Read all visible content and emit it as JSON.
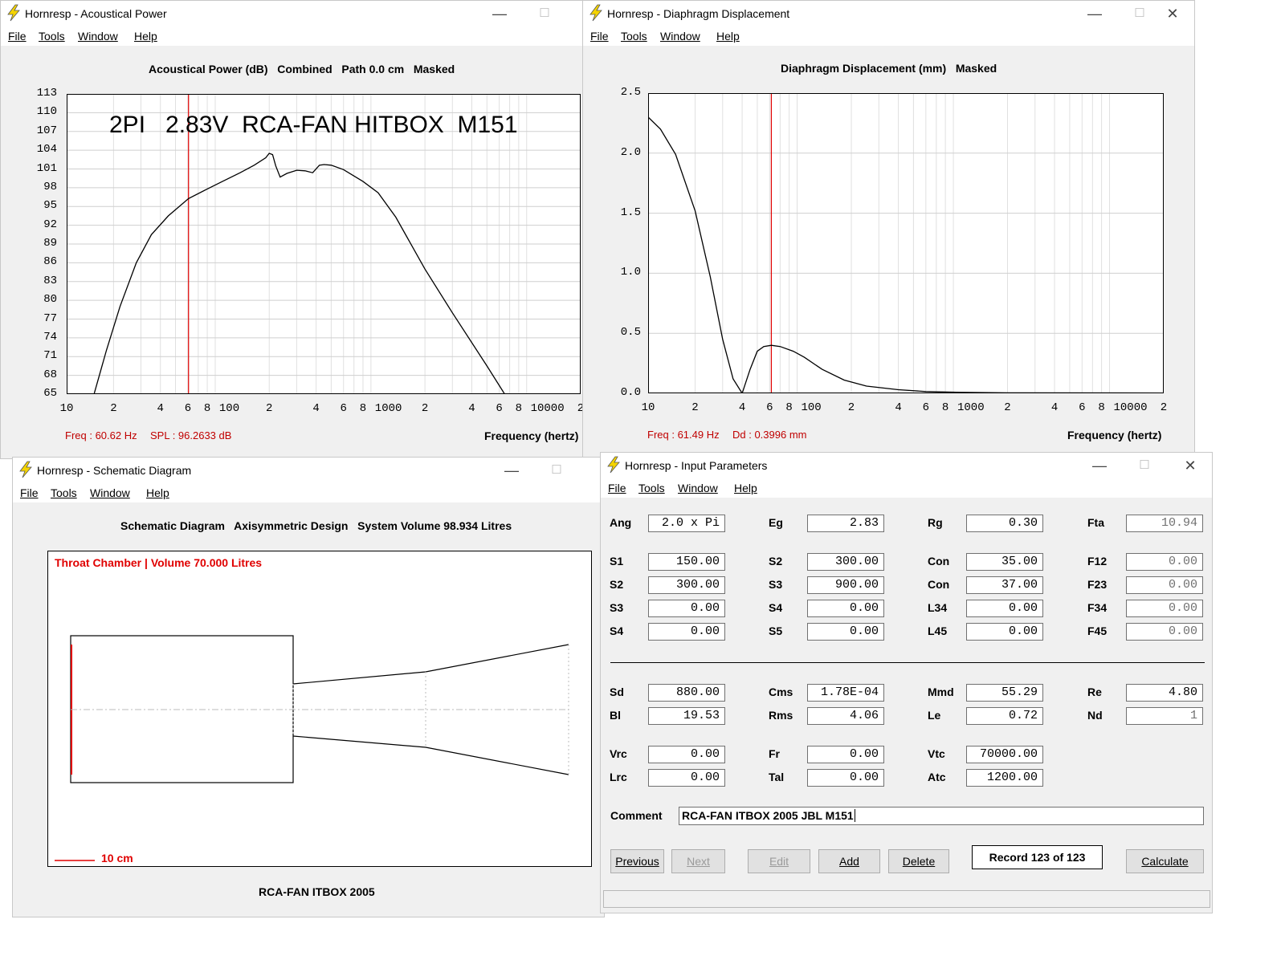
{
  "menus": [
    "File",
    "Tools",
    "Window",
    "Help"
  ],
  "window_controls": {
    "minimize": "—",
    "maximize": "☐",
    "close": "✕"
  },
  "acoustical_power": {
    "window_title": "Hornresp - Acoustical Power",
    "plot_title": "Acoustical Power (dB)   Combined   Path 0.0 cm   Masked",
    "annotation": "2PI   2.83V  RCA-FAN HITBOX  M151",
    "status_freq": "Freq : 60.62 Hz",
    "status_value": "SPL : 96.2633 dB",
    "xlabel": "Frequency (hertz)"
  },
  "diaphragm_displacement": {
    "window_title": "Hornresp - Diaphragm Displacement",
    "plot_title": "Diaphragm Displacement (mm)   Masked",
    "status_freq": "Freq : 61.49 Hz",
    "status_value": "Dd : 0.3996 mm",
    "xlabel": "Frequency (hertz)"
  },
  "chart_data": [
    {
      "type": "line",
      "x_scale": "log",
      "xlim": [
        10,
        20000
      ],
      "ylim": [
        65,
        113
      ],
      "yticks": [
        "113",
        "110",
        "107",
        "104",
        "101",
        "98",
        "95",
        "92",
        "89",
        "86",
        "83",
        "80",
        "77",
        "74",
        "71",
        "68",
        "65"
      ],
      "xticks": [
        "10",
        "2",
        "4",
        "6",
        "8",
        "100",
        "2",
        "4",
        "6",
        "8",
        "1000",
        "2",
        "4",
        "6",
        "8",
        "10000",
        "2"
      ],
      "cursor_x": 60.62,
      "x": [
        15,
        18,
        22,
        28,
        35,
        45,
        60.62,
        80,
        100,
        130,
        160,
        190,
        200,
        210,
        220,
        235,
        260,
        300,
        340,
        380,
        420,
        450,
        500,
        600,
        800,
        1000,
        1300,
        1600,
        2000,
        3000,
        5000,
        6500
      ],
      "y": [
        65,
        72,
        79,
        86,
        90.5,
        93.5,
        96.2633,
        97.8,
        99,
        100.4,
        101.6,
        102.8,
        103.5,
        103.3,
        101.5,
        99.7,
        100.3,
        100.8,
        100.7,
        100.4,
        101.6,
        101.7,
        101.6,
        100.9,
        99,
        97.2,
        93.3,
        89.3,
        85,
        78,
        69.5,
        65
      ]
    },
    {
      "type": "line",
      "x_scale": "log",
      "xlim": [
        10,
        20000
      ],
      "ylim": [
        0,
        2.5
      ],
      "yticks": [
        "2.5",
        "2.0",
        "1.5",
        "1.0",
        "0.5",
        "0.0"
      ],
      "xticks": [
        "10",
        "2",
        "4",
        "6",
        "8",
        "100",
        "2",
        "4",
        "6",
        "8",
        "1000",
        "2",
        "4",
        "6",
        "8",
        "10000",
        "2"
      ],
      "cursor_x": 61.49,
      "x": [
        10,
        12,
        15,
        20,
        25,
        30,
        35,
        40,
        45,
        50,
        55,
        61.49,
        70,
        85,
        100,
        130,
        180,
        250,
        400,
        600,
        1000,
        2000,
        20000
      ],
      "y": [
        2.3,
        2.2,
        1.99,
        1.52,
        0.97,
        0.45,
        0.12,
        0.0,
        0.2,
        0.35,
        0.39,
        0.3996,
        0.39,
        0.35,
        0.3,
        0.2,
        0.11,
        0.06,
        0.03,
        0.015,
        0.008,
        0.004,
        0.003
      ]
    }
  ],
  "schematic": {
    "window_title": "Hornresp - Schematic Diagram",
    "header": "Schematic Diagram   Axisymmetric Design   System Volume 98.934 Litres",
    "chamber_label": "Throat Chamber | Volume 70.000 Litres",
    "scale_label": "10 cm",
    "footer": "RCA-FAN ITBOX 2005"
  },
  "input_parameters": {
    "window_title": "Hornresp - Input Parameters",
    "rows": [
      [
        {
          "label": "Ang",
          "value": "2.0 x Pi",
          "ro": false
        },
        {
          "label": "Eg",
          "value": "2.83",
          "ro": false
        },
        {
          "label": "Rg",
          "value": "0.30",
          "ro": false
        },
        {
          "label": "Fta",
          "value": "10.94",
          "ro": true
        }
      ],
      [
        {
          "label": "S1",
          "value": "150.00",
          "ro": false
        },
        {
          "label": "S2",
          "value": "300.00",
          "ro": false
        },
        {
          "label": "Con",
          "value": "35.00",
          "ro": false
        },
        {
          "label": "F12",
          "value": "0.00",
          "ro": true
        }
      ],
      [
        {
          "label": "S2",
          "value": "300.00",
          "ro": false
        },
        {
          "label": "S3",
          "value": "900.00",
          "ro": false
        },
        {
          "label": "Con",
          "value": "37.00",
          "ro": false
        },
        {
          "label": "F23",
          "value": "0.00",
          "ro": true
        }
      ],
      [
        {
          "label": "S3",
          "value": "0.00",
          "ro": false
        },
        {
          "label": "S4",
          "value": "0.00",
          "ro": false
        },
        {
          "label": "L34",
          "value": "0.00",
          "ro": false
        },
        {
          "label": "F34",
          "value": "0.00",
          "ro": true
        }
      ],
      [
        {
          "label": "S4",
          "value": "0.00",
          "ro": false
        },
        {
          "label": "S5",
          "value": "0.00",
          "ro": false
        },
        {
          "label": "L45",
          "value": "0.00",
          "ro": false
        },
        {
          "label": "F45",
          "value": "0.00",
          "ro": true
        }
      ],
      [
        {
          "label": "Sd",
          "value": "880.00",
          "ro": false
        },
        {
          "label": "Cms",
          "value": "1.78E-04",
          "ro": false
        },
        {
          "label": "Mmd",
          "value": "55.29",
          "ro": false
        },
        {
          "label": "Re",
          "value": "4.80",
          "ro": false
        }
      ],
      [
        {
          "label": "Bl",
          "value": "19.53",
          "ro": false
        },
        {
          "label": "Rms",
          "value": "4.06",
          "ro": false
        },
        {
          "label": "Le",
          "value": "0.72",
          "ro": false
        },
        {
          "label": "Nd",
          "value": "1",
          "ro": true
        }
      ],
      [
        {
          "label": "Vrc",
          "value": "0.00",
          "ro": false
        },
        {
          "label": "Fr",
          "value": "0.00",
          "ro": false
        },
        {
          "label": "Vtc",
          "value": "70000.00",
          "ro": false
        }
      ],
      [
        {
          "label": "Lrc",
          "value": "0.00",
          "ro": false
        },
        {
          "label": "Tal",
          "value": "0.00",
          "ro": false
        },
        {
          "label": "Atc",
          "value": "1200.00",
          "ro": false
        }
      ]
    ],
    "comment_label": "Comment",
    "comment_value": "RCA-FAN ITBOX 2005 JBL M151",
    "buttons": {
      "previous": "Previous",
      "next": "Next",
      "edit": "Edit",
      "add": "Add",
      "delete": "Delete",
      "record": "Record 123 of 123",
      "calculate": "Calculate"
    }
  }
}
